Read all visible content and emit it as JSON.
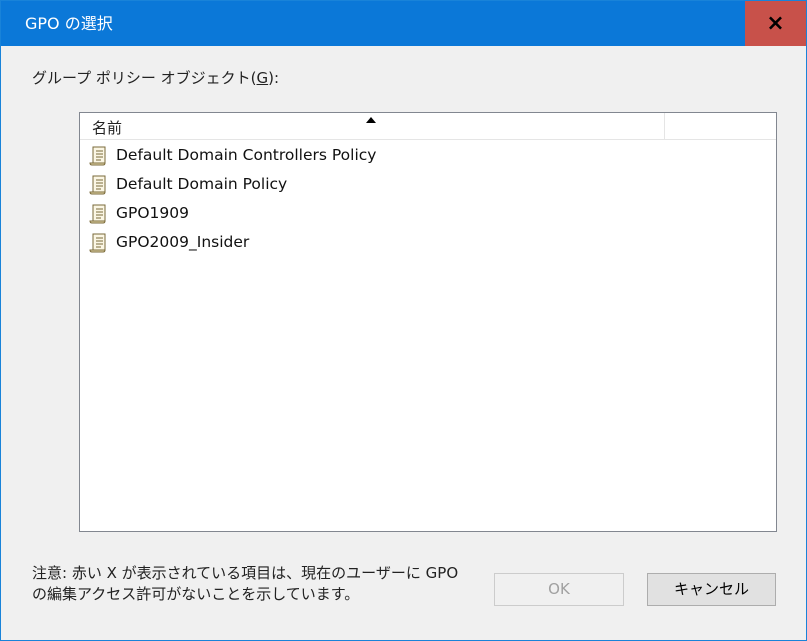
{
  "window": {
    "title": "GPO の選択",
    "close_label": "×"
  },
  "group_label": {
    "text_before": "グループ ポリシー オブジェクト(",
    "accelerator": "G",
    "text_after": "):"
  },
  "list": {
    "column_header": "名前",
    "items": [
      {
        "name": "Default Domain Controllers Policy",
        "icon": "gpo-scroll-icon"
      },
      {
        "name": "Default Domain Policy",
        "icon": "gpo-scroll-icon"
      },
      {
        "name": "GPO1909",
        "icon": "gpo-scroll-icon"
      },
      {
        "name": "GPO2009_Insider",
        "icon": "gpo-scroll-icon"
      }
    ]
  },
  "note": {
    "line1": "注意: 赤い X が表示されている項目は、現在のユーザーに GPO",
    "line2": "の編集アクセス許可がないことを示しています。"
  },
  "buttons": {
    "ok_label": "OK",
    "ok_enabled": false,
    "cancel_label": "キャンセル"
  },
  "colors": {
    "titlebar": "#0b78d8",
    "close_button": "#c8514a",
    "dialog_background": "#f0f0f0"
  }
}
